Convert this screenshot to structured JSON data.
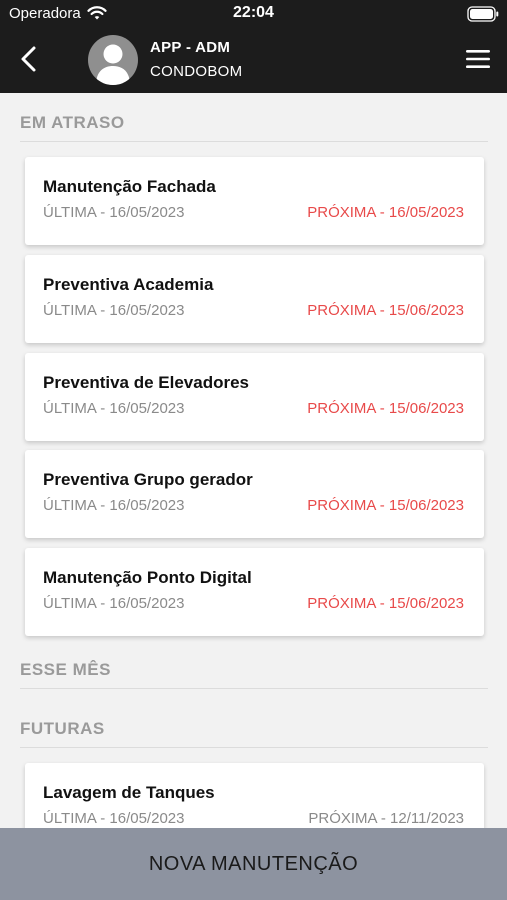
{
  "status_bar": {
    "carrier": "Operadora",
    "time": "22:04"
  },
  "header": {
    "title": "APP - ADM",
    "subtitle": "CONDOBOM"
  },
  "sections": {
    "overdue": {
      "label": "EM ATRASO",
      "items": [
        {
          "title": "Manutenção Fachada",
          "last": "ÚLTIMA - 16/05/2023",
          "next": "PRÓXIMA - 16/05/2023"
        },
        {
          "title": "Preventiva Academia",
          "last": "ÚLTIMA - 16/05/2023",
          "next": "PRÓXIMA - 15/06/2023"
        },
        {
          "title": "Preventiva de Elevadores",
          "last": "ÚLTIMA - 16/05/2023",
          "next": "PRÓXIMA - 15/06/2023"
        },
        {
          "title": "Preventiva Grupo gerador",
          "last": "ÚLTIMA - 16/05/2023",
          "next": "PRÓXIMA - 15/06/2023"
        },
        {
          "title": "Manutenção Ponto Digital",
          "last": "ÚLTIMA - 16/05/2023",
          "next": "PRÓXIMA - 15/06/2023"
        }
      ]
    },
    "this_month": {
      "label": "ESSE MÊS"
    },
    "future": {
      "label": "FUTURAS",
      "items": [
        {
          "title": "Lavagem de Tanques",
          "last": "ÚLTIMA - 16/05/2023",
          "next": "PRÓXIMA - 12/11/2023"
        }
      ]
    }
  },
  "bottom_button": {
    "label": "NOVA MANUTENÇÃO"
  },
  "colors": {
    "overdue_next": "#e84a4a",
    "header_bg": "#1c1c1c",
    "bottom_button_bg": "#8d93a0"
  },
  "icons": {
    "back": "chevron-left-icon",
    "menu": "hamburger-menu-icon",
    "avatar": "user-avatar-icon"
  }
}
